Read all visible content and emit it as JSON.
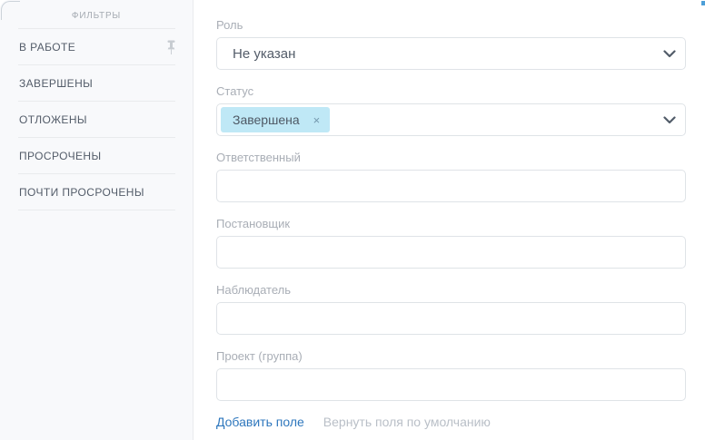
{
  "panel": {
    "type": "filter-popup"
  },
  "sidebar": {
    "header": "ФИЛЬТРЫ",
    "items": [
      {
        "label": "В РАБОТЕ",
        "pinned": true
      },
      {
        "label": "ЗАВЕРШЕНЫ",
        "pinned": false
      },
      {
        "label": "ОТЛОЖЕНЫ",
        "pinned": false
      },
      {
        "label": "ПРОСРОЧЕНЫ",
        "pinned": false
      },
      {
        "label": "ПОЧТИ ПРОСРОЧЕНЫ",
        "pinned": false
      }
    ]
  },
  "form": {
    "fields": [
      {
        "label": "Роль",
        "type": "select",
        "value": "Не указан"
      },
      {
        "label": "Статус",
        "type": "multiselect",
        "tags": [
          "Завершена"
        ]
      },
      {
        "label": "Ответственный",
        "type": "input",
        "value": "",
        "placeholder": ""
      },
      {
        "label": "Постановщик",
        "type": "input",
        "value": "",
        "placeholder": ""
      },
      {
        "label": "Наблюдатель",
        "type": "input",
        "value": "",
        "placeholder": ""
      },
      {
        "label": "Проект (группа)",
        "type": "input",
        "value": "",
        "placeholder": ""
      }
    ],
    "tag_remove_glyph": "×",
    "add_field_label": "Добавить поле",
    "reset_fields_label": "Вернуть поля по умолчанию"
  },
  "colors": {
    "sidebar_bg": "#f8f9fb",
    "divider": "#e9ebed",
    "text_dark": "#535c69",
    "text_muted": "#a9aeb6",
    "tag_bg": "#bfe8f6",
    "link_blue": "#2e77bd",
    "link_gray": "#b9bfc7",
    "border": "#dfe3e7"
  },
  "icons": {
    "pin": "pin-icon",
    "chevron": "chevron-down-icon",
    "tag_close": "close-icon"
  }
}
